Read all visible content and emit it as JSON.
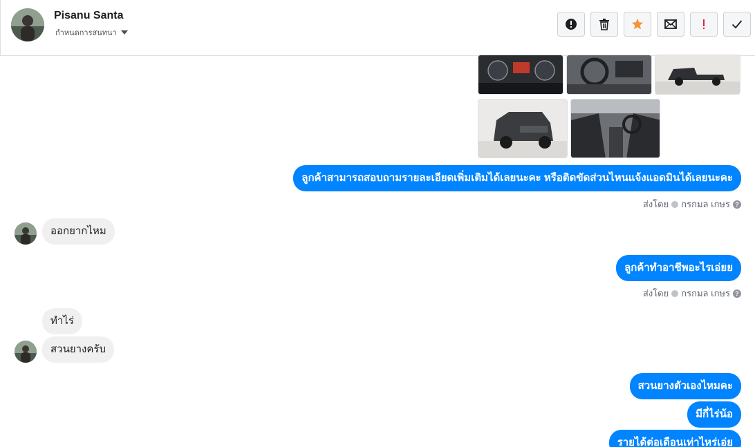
{
  "header": {
    "name": "Pisanu Santa",
    "subtitle": "กำหนดการสนทนา",
    "toolbar": [
      {
        "icon": "alert-circle-icon",
        "label": "alert"
      },
      {
        "icon": "trash-icon",
        "label": "delete"
      },
      {
        "icon": "star-icon",
        "label": "star"
      },
      {
        "icon": "envelope-icon",
        "label": "mail"
      },
      {
        "icon": "exclamation-icon",
        "label": "important"
      },
      {
        "icon": "checkmark-icon",
        "label": "done"
      }
    ]
  },
  "messages": {
    "out1": "ลูกค้าสามารถสอบถามรายละเอียดเพิ่มเติมได้เลยนะคะ หรือติดขัดส่วนไหนแจ้งแอดมินได้เลยนะคะ",
    "sent_by_label": "ส่งโดย",
    "sent_by_name": "กรกมล เกษร",
    "sent_by_help": "?",
    "in1": "ออกยากไหม",
    "out2": "ลูกค้าทำอาชีพอะไรเอ่ยย",
    "in2": "ทำไร่",
    "in3": "สวนยางครับ",
    "out3": "สวนยางตัวเองไหมคะ",
    "out4": "มีกี่ไร่น้อ",
    "out5": "รายได้ต่อเดือนเท่าไหร่เอ่ย"
  },
  "colors": {
    "accent": "#0084ff",
    "incoming": "#f1f0f0",
    "star": "#f7923a",
    "important": "#e41e3f"
  }
}
